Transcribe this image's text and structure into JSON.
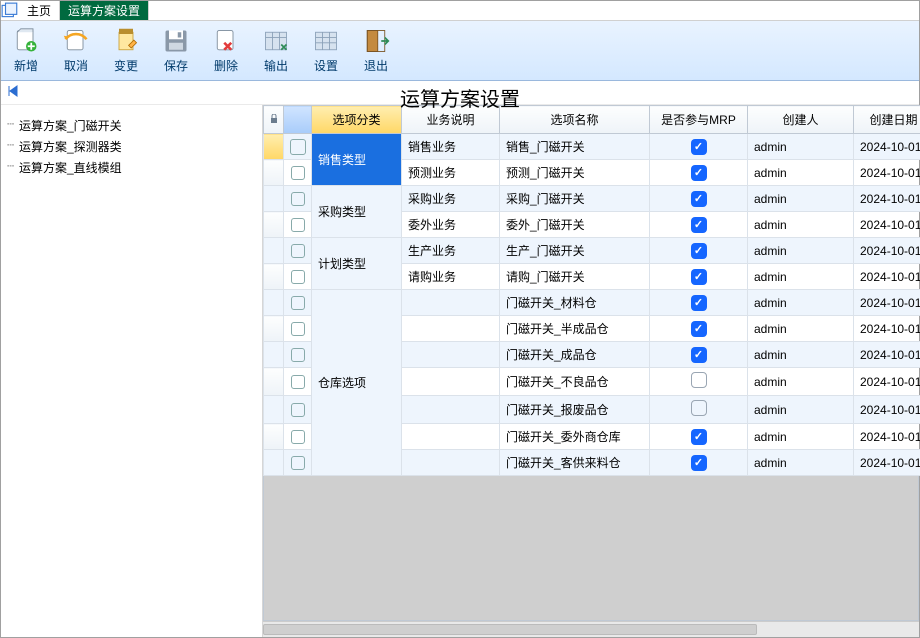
{
  "tabs": {
    "home": "主页",
    "active": "运算方案设置"
  },
  "toolbar": {
    "add": "新增",
    "cancel": "取消",
    "change": "变更",
    "save": "保存",
    "delete": "删除",
    "export": "输出",
    "settings": "设置",
    "exit": "退出"
  },
  "page_title": "运算方案设置",
  "tree": [
    "运算方案_门磁开关",
    "运算方案_探测器类",
    "运算方案_直线模组"
  ],
  "columns": {
    "category": "选项分类",
    "biz": "业务说明",
    "name": "选项名称",
    "mrp": "是否参与MRP",
    "creator": "创建人",
    "date": "创建日期"
  },
  "groups": [
    {
      "category": "销售类型",
      "selected": true,
      "rows": [
        {
          "biz": "销售业务",
          "name": "销售_门磁开关",
          "mrp": true,
          "creator": "admin",
          "date": "2024-10-01",
          "mark": true
        },
        {
          "biz": "预测业务",
          "name": "预测_门磁开关",
          "mrp": true,
          "creator": "admin",
          "date": "2024-10-01"
        }
      ]
    },
    {
      "category": "采购类型",
      "rows": [
        {
          "biz": "采购业务",
          "name": "采购_门磁开关",
          "mrp": true,
          "creator": "admin",
          "date": "2024-10-01"
        },
        {
          "biz": "委外业务",
          "name": "委外_门磁开关",
          "mrp": true,
          "creator": "admin",
          "date": "2024-10-01"
        }
      ]
    },
    {
      "category": "计划类型",
      "rows": [
        {
          "biz": "生产业务",
          "name": "生产_门磁开关",
          "mrp": true,
          "creator": "admin",
          "date": "2024-10-01"
        },
        {
          "biz": "请购业务",
          "name": "请购_门磁开关",
          "mrp": true,
          "creator": "admin",
          "date": "2024-10-01"
        }
      ]
    },
    {
      "category": "仓库选项",
      "rows": [
        {
          "biz": "",
          "name": "门磁开关_材料仓",
          "mrp": true,
          "creator": "admin",
          "date": "2024-10-01"
        },
        {
          "biz": "",
          "name": "门磁开关_半成品仓",
          "mrp": true,
          "creator": "admin",
          "date": "2024-10-01"
        },
        {
          "biz": "",
          "name": "门磁开关_成品仓",
          "mrp": true,
          "creator": "admin",
          "date": "2024-10-01"
        },
        {
          "biz": "",
          "name": "门磁开关_不良品仓",
          "mrp": false,
          "creator": "admin",
          "date": "2024-10-01"
        },
        {
          "biz": "",
          "name": "门磁开关_报废品仓",
          "mrp": false,
          "creator": "admin",
          "date": "2024-10-01"
        },
        {
          "biz": "",
          "name": "门磁开关_委外商仓库",
          "mrp": true,
          "creator": "admin",
          "date": "2024-10-01"
        },
        {
          "biz": "",
          "name": "门磁开关_客供来料仓",
          "mrp": true,
          "creator": "admin",
          "date": "2024-10-01"
        }
      ]
    }
  ]
}
